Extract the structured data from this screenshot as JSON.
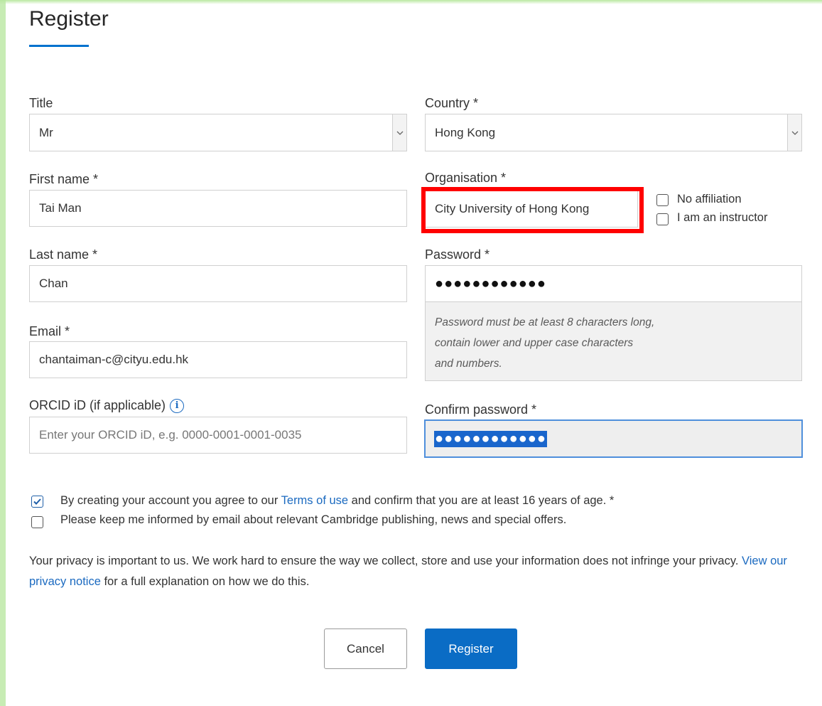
{
  "page": {
    "title": "Register"
  },
  "fields": {
    "title": {
      "label": "Title",
      "value": "Mr"
    },
    "country": {
      "label": "Country *",
      "value": "Hong Kong"
    },
    "first_name": {
      "label": "First name *",
      "value": "Tai Man"
    },
    "organisation": {
      "label": "Organisation *",
      "value": "City University of Hong Kong"
    },
    "no_affiliation": {
      "label": "No affiliation",
      "checked": false
    },
    "instructor": {
      "label": "I am an instructor",
      "checked": false
    },
    "last_name": {
      "label": "Last name *",
      "value": "Chan"
    },
    "password": {
      "label": "Password *",
      "masked_value": "●●●●●●●●●●●●",
      "hint_lines": [
        "Password must be at least 8 characters long,",
        "contain lower and upper case characters",
        "and numbers."
      ]
    },
    "email": {
      "label": "Email *",
      "value": "chantaiman-c@cityu.edu.hk"
    },
    "orcid": {
      "label": "ORCID iD (if applicable)",
      "placeholder": "Enter your ORCID iD, e.g. 0000-0001-0001-0035"
    },
    "confirm_password": {
      "label": "Confirm password *",
      "masked_value": "●●●●●●●●●●●●"
    }
  },
  "agreements": {
    "terms": {
      "checked": true,
      "before": "By creating your account you agree to our ",
      "link": "Terms of use",
      "after": " and confirm that you are at least 16 years of age. *"
    },
    "newsletter": {
      "checked": false,
      "text": "Please keep me informed by email about relevant Cambridge publishing, news and special offers."
    }
  },
  "privacy": {
    "before": "Your privacy is important to us. We work hard to ensure the way we collect, store and use your information does not infringe your privacy. ",
    "link": "View our privacy notice",
    "after": " for a full explanation on how we do this."
  },
  "buttons": {
    "cancel": "Cancel",
    "register": "Register"
  },
  "colors": {
    "accent": "#0072ce",
    "highlight": "#ff0000",
    "link": "#1b6ac0"
  }
}
